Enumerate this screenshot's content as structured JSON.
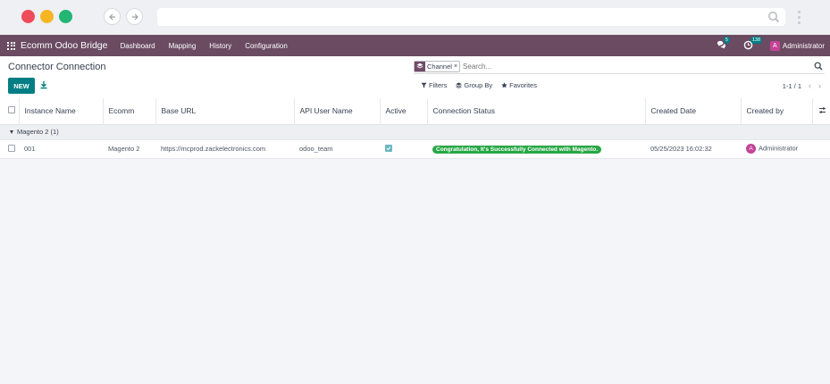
{
  "browser": {
    "url": ""
  },
  "navbar": {
    "brand": "Ecomm Odoo Bridge",
    "menu": [
      "Dashboard",
      "Mapping",
      "History",
      "Configuration"
    ],
    "messages_count": "5",
    "activities_count": "138",
    "user_initial": "A",
    "user_name": "Administrator"
  },
  "control_panel": {
    "title": "Connector Connection",
    "new_label": "NEW",
    "facet_value": "Channel",
    "facet_remove": "×",
    "search_placeholder": "Search...",
    "filters_label": "Filters",
    "groupby_label": "Group By",
    "favorites_label": "Favorites",
    "pager": "1-1 / 1"
  },
  "table": {
    "columns": [
      "Instance Name",
      "Ecomm",
      "Base URL",
      "API User Name",
      "Active",
      "Connection Status",
      "Created Date",
      "Created by"
    ],
    "group": {
      "label": "Magento 2 (1)"
    },
    "rows": [
      {
        "instance": "001",
        "ecomm": "Magento 2",
        "base_url": "https://mcprod.zackelectronics.com",
        "api_user": "odoo_team",
        "active": true,
        "status": "Congratulation, It's Successfully Connected with Magento.",
        "created_date": "05/25/2023 16:02:32",
        "created_by_initial": "A",
        "created_by": "Administrator"
      }
    ]
  },
  "colors": {
    "navbar": "#6a4b62",
    "primary": "#017e84",
    "success": "#28a745",
    "avatar": "#c44397"
  }
}
